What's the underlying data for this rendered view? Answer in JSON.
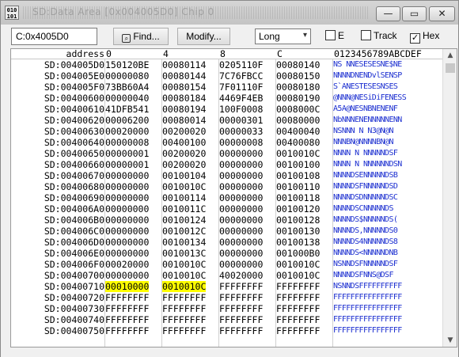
{
  "window": {
    "title": "SD:Data Area [0x004005D0] Chip 0",
    "icon_text": "010\n101",
    "buttons": {
      "minimize": "—",
      "restore": "▭",
      "close": "✕"
    }
  },
  "toolbar": {
    "address_value": "C:0x4005D0",
    "find_label": "Find...",
    "modify_label": "Modify...",
    "format_selected": "Long",
    "checkbox_e": {
      "label": "E",
      "checked": false
    },
    "checkbox_track": {
      "label": "Track",
      "checked": false
    },
    "checkbox_hex": {
      "label": "Hex",
      "checked": true
    }
  },
  "table": {
    "headers": {
      "address": "address",
      "c0": "0",
      "c1": "4",
      "c2": "8",
      "c3": "C",
      "ascii": "0123456789ABCDEF"
    },
    "rows": [
      {
        "addr": "SD:004005D0",
        "v": [
          "150120BE",
          "00080114",
          "0205110F",
          "00080140"
        ],
        "asc": "NS NNESESESNE$NE"
      },
      {
        "addr": "SD:004005E0",
        "v": [
          "00000080",
          "00080144",
          "7C76FBCC",
          "00080150"
        ],
        "asc": "NNNNDNENDvlSENSP"
      },
      {
        "addr": "SD:004005F0",
        "v": [
          "73BB60A4",
          "00080154",
          "7F01110F",
          "00080180"
        ],
        "asc": "S`ANESTESESNSES"
      },
      {
        "addr": "SD:00400600",
        "v": [
          "00000040",
          "00080184",
          "4469F4EB",
          "00080190"
        ],
        "asc": "@NNN@NESiDiFENESS"
      },
      {
        "addr": "SD:00400610",
        "v": [
          "41DFB541",
          "00080194",
          "100F0008",
          "0008000C"
        ],
        "asc": "A5A@NESNBNENENF"
      },
      {
        "addr": "SD:00400620",
        "v": [
          "00006200",
          "00080014",
          "00000301",
          "00080000"
        ],
        "asc": "NbNNNENENNNNNENN"
      },
      {
        "addr": "SD:00400630",
        "v": [
          "00020000",
          "00200020",
          "00000033",
          "00400040"
        ],
        "asc": "NSNNN N N3@N@N"
      },
      {
        "addr": "SD:00400640",
        "v": [
          "00000008",
          "00400100",
          "00000008",
          "00400080"
        ],
        "asc": "NNNBN@NNNNBN@N"
      },
      {
        "addr": "SD:00400650",
        "v": [
          "00000001",
          "00200020",
          "00000000",
          "0010010C"
        ],
        "asc": "NNNN N NNNNNDSF"
      },
      {
        "addr": "SD:00400660",
        "v": [
          "00000001",
          "00200020",
          "00000000",
          "00100100"
        ],
        "asc": "NNNN N NNNNNNDSN"
      },
      {
        "addr": "SD:00400670",
        "v": [
          "00000000",
          "00100104",
          "00000000",
          "00100108"
        ],
        "asc": "NNNNDSENNNNNDSB"
      },
      {
        "addr": "SD:00400680",
        "v": [
          "00000000",
          "0010010C",
          "00000000",
          "00100110"
        ],
        "asc": "NNNNDSFNNNNNDSD"
      },
      {
        "addr": "SD:00400690",
        "v": [
          "00000000",
          "00100114",
          "00000000",
          "00100118"
        ],
        "asc": "NNNNDSDNNNNNDSC"
      },
      {
        "addr": "SD:004006A0",
        "v": [
          "00000000",
          "0010011C",
          "00000000",
          "00100120"
        ],
        "asc": "NNNNDSCNNNNNDS "
      },
      {
        "addr": "SD:004006B0",
        "v": [
          "00000000",
          "00100124",
          "00000000",
          "00100128"
        ],
        "asc": "NNNNDS$NNNNNDS("
      },
      {
        "addr": "SD:004006C0",
        "v": [
          "00000000",
          "0010012C",
          "00000000",
          "00100130"
        ],
        "asc": "NNNNDS,NNNNNDS0"
      },
      {
        "addr": "SD:004006D0",
        "v": [
          "00000000",
          "00100134",
          "00000000",
          "00100138"
        ],
        "asc": "NNNNDS4NNNNNDS8"
      },
      {
        "addr": "SD:004006E0",
        "v": [
          "00000000",
          "0010013C",
          "00000000",
          "001000B0"
        ],
        "asc": "NNNNDS<NNNNNDNB"
      },
      {
        "addr": "SD:004006F0",
        "v": [
          "00020000",
          "0010010C",
          "00000000",
          "0010010C"
        ],
        "asc": "NSNNDSFNNNNNDSF"
      },
      {
        "addr": "SD:00400700",
        "v": [
          "00000000",
          "0010010C",
          "40020000",
          "0010010C"
        ],
        "asc": "NNNNDSFNNS@DSF"
      },
      {
        "addr": "SD:00400710",
        "v": [
          "00010000",
          "0010010C",
          "FFFFFFFF",
          "FFFFFFFF"
        ],
        "asc": "NSNNDSFFFFFFFFFF",
        "hl": [
          true,
          true,
          false,
          false
        ]
      },
      {
        "addr": "SD:00400720",
        "v": [
          "FFFFFFFF",
          "FFFFFFFF",
          "FFFFFFFF",
          "FFFFFFFF"
        ],
        "asc": "FFFFFFFFFFFFFFFF"
      },
      {
        "addr": "SD:00400730",
        "v": [
          "FFFFFFFF",
          "FFFFFFFF",
          "FFFFFFFF",
          "FFFFFFFF"
        ],
        "asc": "FFFFFFFFFFFFFFFF"
      },
      {
        "addr": "SD:00400740",
        "v": [
          "FFFFFFFF",
          "FFFFFFFF",
          "FFFFFFFF",
          "FFFFFFFF"
        ],
        "asc": "FFFFFFFFFFFFFFFF"
      },
      {
        "addr": "SD:00400750",
        "v": [
          "FFFFFFFF",
          "FFFFFFFF",
          "FFFFFFFF",
          "FFFFFFFF"
        ],
        "asc": "FFFFFFFFFFFFFFFF"
      }
    ]
  },
  "colors": {
    "highlight": "#ffff00",
    "ascii_text": "#1c2fd0"
  }
}
